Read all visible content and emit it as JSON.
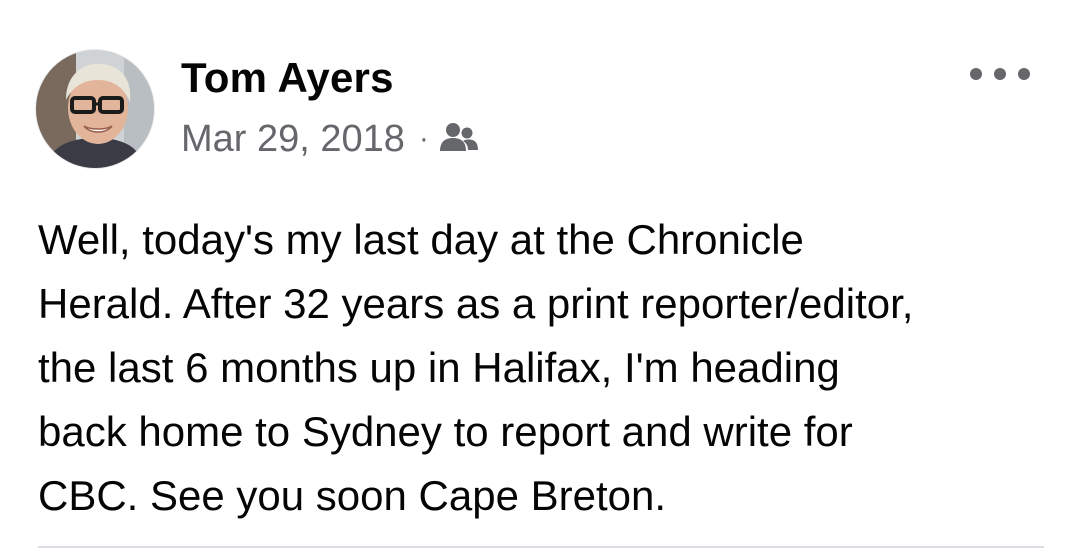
{
  "post": {
    "author_name": "Tom Ayers",
    "date": "Mar 29, 2018",
    "separator": "·",
    "audience_icon": "friends-icon",
    "more_icon": "more-options-icon",
    "message_lines": [
      "Well, today's my last day at the Chronicle",
      "Herald. After 32 years as a print reporter/editor,",
      "the last 6 months up in Halifax, I'm heading",
      "back home to Sydney to report and write for",
      "CBC. See you soon Cape Breton."
    ]
  },
  "colors": {
    "primary_text": "#050505",
    "secondary_text": "#65676b",
    "divider": "#dadde1"
  }
}
